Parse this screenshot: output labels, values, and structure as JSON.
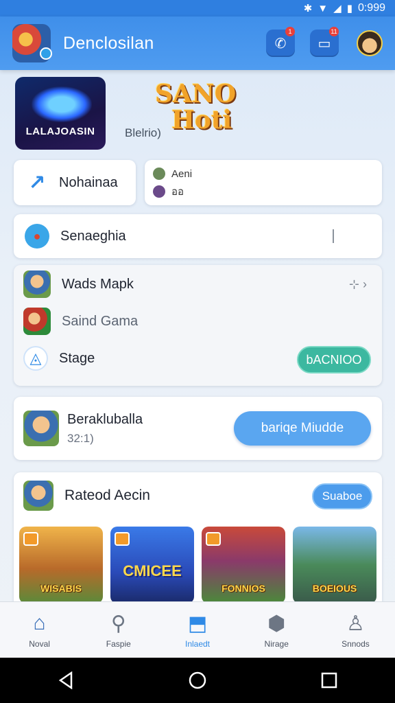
{
  "status_bar": {
    "time": "0:999",
    "icons": [
      "bluetooth-icon",
      "wifi-icon",
      "signal-icon",
      "battery-icon"
    ]
  },
  "header": {
    "title": "Denclosilan",
    "call_badge": "1",
    "msg_badge": "11"
  },
  "featured": {
    "tile_label": "LALAJOASIN",
    "logo_line1": "SANO",
    "logo_line2": "Hoti",
    "caption": "Blelrio)"
  },
  "quick_cards": {
    "left_label": "Nohainaa",
    "right_items": [
      "Aeni",
      "ออ"
    ]
  },
  "search_card": {
    "label": "Senaeghia"
  },
  "list": {
    "items": [
      "Wads Mapk",
      "Saind Gama",
      "Stage"
    ],
    "action": "bACNIOO"
  },
  "promo_card": {
    "title": "Berakluballa",
    "subtitle": "32:1)",
    "button": "bariqe Miudde"
  },
  "rated": {
    "title": "Rateod Aecin",
    "button": "Suaboe",
    "tiles": [
      "WISABIS",
      "CMICEE",
      "FONNIOS",
      "BOEIOUS"
    ]
  },
  "bottom_nav": [
    "Noval",
    "Faspie",
    "Inlaedt",
    "Nirage",
    "Snnods"
  ],
  "colors": {
    "primary": "#3f8fea",
    "accent_green": "#3cb8a0",
    "button_blue": "#5aa6f0"
  }
}
